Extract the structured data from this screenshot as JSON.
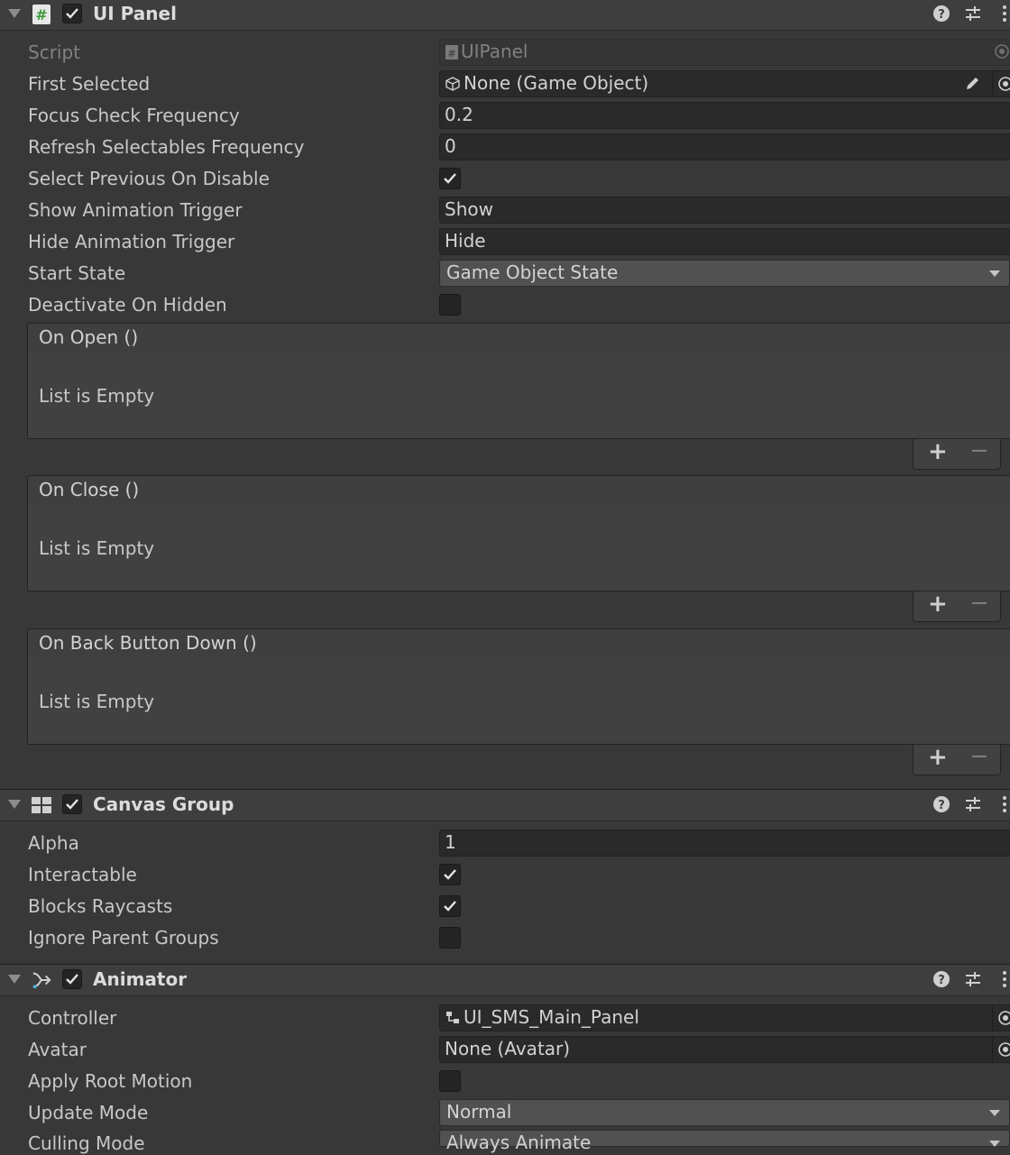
{
  "ui_panel": {
    "title": "UI Panel",
    "script_label": "Script",
    "script_value": "UIPanel",
    "first_selected_label": "First Selected",
    "first_selected_value": "None (Game Object)",
    "focus_label": "Focus Check Frequency",
    "focus_value": "0.2",
    "refresh_label": "Refresh Selectables Frequency",
    "refresh_value": "0",
    "select_prev_label": "Select Previous On Disable",
    "select_prev_checked": true,
    "show_trigger_label": "Show Animation Trigger",
    "show_trigger_value": "Show",
    "hide_trigger_label": "Hide Animation Trigger",
    "hide_trigger_value": "Hide",
    "start_state_label": "Start State",
    "start_state_value": "Game Object State",
    "deactivate_label": "Deactivate On Hidden",
    "deactivate_checked": false,
    "events": [
      {
        "title": "On Open ()",
        "empty": "List is Empty"
      },
      {
        "title": "On Close ()",
        "empty": "List is Empty"
      },
      {
        "title": "On Back Button Down ()",
        "empty": "List is Empty"
      }
    ]
  },
  "canvas_group": {
    "title": "Canvas Group",
    "alpha_label": "Alpha",
    "alpha_value": "1",
    "interactable_label": "Interactable",
    "interactable_checked": true,
    "blocks_label": "Blocks Raycasts",
    "blocks_checked": true,
    "ignore_label": "Ignore Parent Groups",
    "ignore_checked": false
  },
  "animator": {
    "title": "Animator",
    "controller_label": "Controller",
    "controller_value": "UI_SMS_Main_Panel",
    "avatar_label": "Avatar",
    "avatar_value": "None (Avatar)",
    "root_motion_label": "Apply Root Motion",
    "root_motion_checked": false,
    "update_label": "Update Mode",
    "update_value": "Normal",
    "culling_label": "Culling Mode",
    "culling_value": "Always Animate"
  },
  "icons": {
    "foldout": "foldout-arrow-icon",
    "script": "csharp-script-icon",
    "canvas_group": "canvas-group-icon",
    "animator": "animator-icon",
    "help": "help-icon",
    "presets": "presets-icon",
    "menu": "kebab-menu-icon",
    "object_picker": "object-picker-icon",
    "edit": "pencil-icon",
    "gameobject": "cube-icon",
    "controller": "animator-controller-icon"
  },
  "colors": {
    "background": "#383838",
    "header": "#3e3e3e",
    "field": "#2a2a2a",
    "dropdown": "#515151",
    "script_icon_green": "#4cbf4c"
  },
  "event_buttons": {
    "add": "+",
    "remove": "−"
  }
}
